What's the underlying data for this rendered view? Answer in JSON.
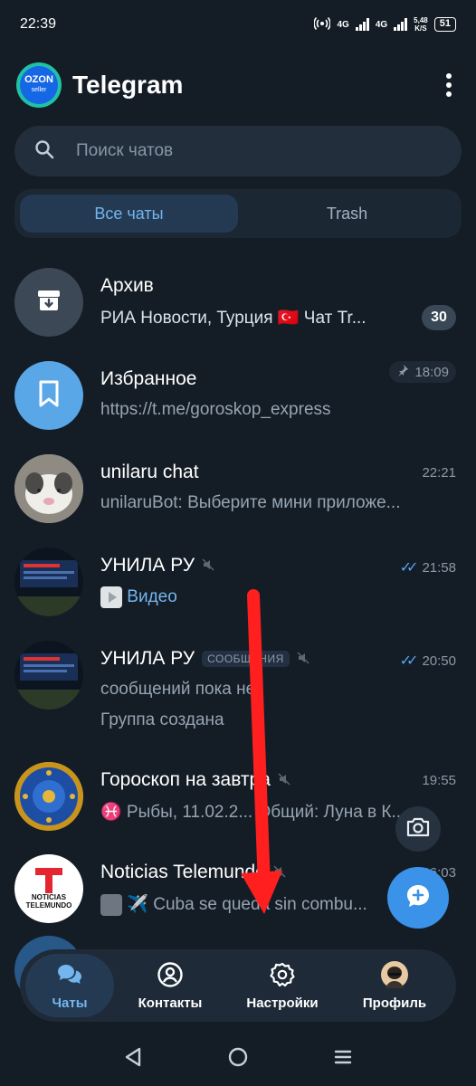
{
  "status_bar": {
    "time": "22:39",
    "net1": "4G",
    "net2": "4G",
    "speed_value": "5,48",
    "speed_unit": "K/S",
    "battery": "51"
  },
  "header": {
    "logo_text": "OZON",
    "logo_sub": "seller",
    "title": "Telegram"
  },
  "search": {
    "placeholder": "Поиск чатов"
  },
  "tabs": [
    {
      "label": "Все чаты",
      "active": true
    },
    {
      "label": "Trash",
      "active": false
    }
  ],
  "chats": [
    {
      "title": "Архив",
      "message": "РИА Новости, Турция 🇹🇷 Чат Tr...",
      "badge": "30",
      "avatar_icon": "archive-icon"
    },
    {
      "title": "Избранное",
      "message": "https://t.me/goroskop_express",
      "time": "18:09",
      "pinned": true,
      "avatar_icon": "bookmark-icon"
    },
    {
      "title": "unilaru chat",
      "message": "unilaruBot: Выберите мини приложе...",
      "time": "22:21"
    },
    {
      "title": "УНИЛА РУ",
      "message": "Видео",
      "time": "21:58",
      "muted": true,
      "read": true
    },
    {
      "title": "УНИЛА РУ",
      "tag": "СООБЩЕНИЯ",
      "message": "сообщений пока нет",
      "message2": "Группа создана",
      "time": "20:50",
      "muted": true,
      "read": true
    },
    {
      "title": "Гороскоп на завтра",
      "message": "♓ Рыбы, 11.02.2... Общий: Луна в К...",
      "time": "19:55",
      "muted": true
    },
    {
      "title": "Noticias Telemundo",
      "message": "✈️ Cuba se queda sin combu...",
      "time": "06:03",
      "muted": true,
      "avatar_text": "NOTICIAS TELEMUNDO"
    }
  ],
  "bottom_nav": [
    {
      "label": "Чаты",
      "icon": "chats-icon",
      "active": true
    },
    {
      "label": "Контакты",
      "icon": "contacts-icon",
      "active": false
    },
    {
      "label": "Настройки",
      "icon": "settings-icon",
      "active": false
    },
    {
      "label": "Профиль",
      "icon": "profile-icon",
      "active": false
    }
  ],
  "colors": {
    "background": "#141d26",
    "accent": "#74b5ee",
    "fab": "#3a93e8",
    "arrow": "#ff1f1f"
  }
}
